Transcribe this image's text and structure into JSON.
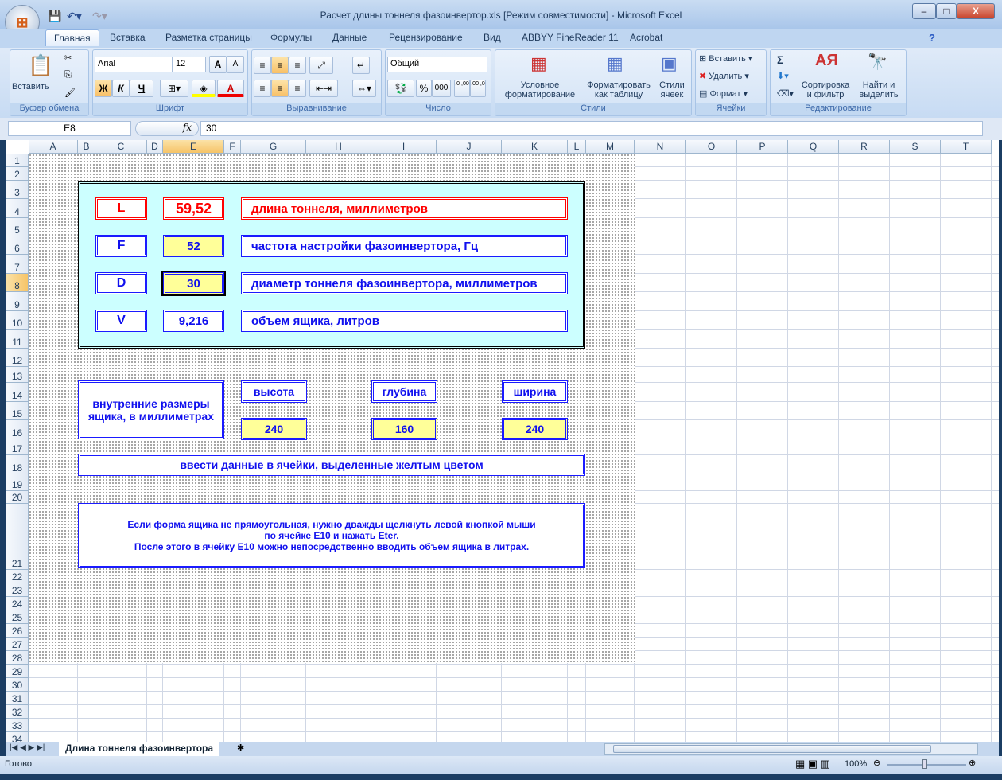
{
  "window": {
    "title": "Расчет длины тоннеля фазоинвертор.xls  [Режим совместимости] - Microsoft Excel",
    "minimize": "–",
    "maximize": "□",
    "close": "X"
  },
  "tabs": [
    "Главная",
    "Вставка",
    "Разметка страницы",
    "Формулы",
    "Данные",
    "Рецензирование",
    "Вид",
    "ABBYY FineReader 11",
    "Acrobat"
  ],
  "ribbon": {
    "clipboard": {
      "label": "Буфер обмена",
      "paste": "Вставить"
    },
    "font": {
      "label": "Шрифт",
      "name": "Arial",
      "size": "12",
      "bold": "Ж",
      "italic": "К",
      "underline": "Ч",
      "grow": "A",
      "shrink": "A",
      "fontcolor": "A"
    },
    "alignment": {
      "label": "Выравнивание"
    },
    "number": {
      "label": "Число",
      "format": "Общий",
      "percent": "%",
      "thousands": "000",
      "inc": ",0 ,00",
      "dec": ",00 ,0"
    },
    "styles": {
      "label": "Стили",
      "conditional": "Условное форматирование",
      "as_table": "Форматировать как таблицу",
      "cell_styles": "Стили ячеек"
    },
    "cells": {
      "label": "Ячейки",
      "insert": "Вставить",
      "delete": "Удалить",
      "format": "Формат"
    },
    "editing": {
      "label": "Редактирование",
      "sum": "Σ",
      "sort": "Сортировка и фильтр",
      "find": "Найти и выделить"
    }
  },
  "formula_bar": {
    "name_box": "E8",
    "fx": "fx",
    "value": "30"
  },
  "columns": [
    "A",
    "B",
    "C",
    "D",
    "E",
    "F",
    "G",
    "H",
    "I",
    "J",
    "K",
    "L",
    "M",
    "N",
    "O",
    "P",
    "Q",
    "R",
    "S",
    "T"
  ],
  "rows": [
    "1",
    "2",
    "3",
    "4",
    "5",
    "6",
    "7",
    "8",
    "9",
    "10",
    "11",
    "12",
    "13",
    "14",
    "15",
    "16",
    "17",
    "18",
    "19",
    "20",
    "21",
    "22",
    "23",
    "24",
    "25",
    "26",
    "27",
    "28",
    "29",
    "30",
    "31",
    "32",
    "33",
    "34"
  ],
  "form": {
    "params": [
      {
        "symbol": "L",
        "value": "59,52",
        "desc": "длина тоннеля, миллиметров"
      },
      {
        "symbol": "F",
        "value": "52",
        "desc": "частота настройки фазоинвертора, Гц"
      },
      {
        "symbol": "D",
        "value": "30",
        "desc": "диаметр тоннеля фазоинвертора, миллиметров"
      },
      {
        "symbol": "V",
        "value": "9,216",
        "desc": "объем ящика, литров"
      }
    ],
    "dims_label": "внутренние размеры ящика, в миллиметрах",
    "dims": [
      {
        "label": "высота",
        "value": "240"
      },
      {
        "label": "глубина",
        "value": "160"
      },
      {
        "label": "ширина",
        "value": "240"
      }
    ],
    "instruction": "ввести данные в ячейки, выделенные желтым цветом",
    "note": [
      "Если форма ящика не прямоугольная, нужно дважды щелкнуть левой кнопкой мыши",
      "по ячейке E10 и нажать Eter.",
      "После этого в ячейку E10 можно непосредственно вводить объем ящика в литрах."
    ]
  },
  "sheet_tabs": [
    "Длина тоннеля фазоинвертора"
  ],
  "status": {
    "ready": "Готово",
    "zoom": "100%"
  }
}
